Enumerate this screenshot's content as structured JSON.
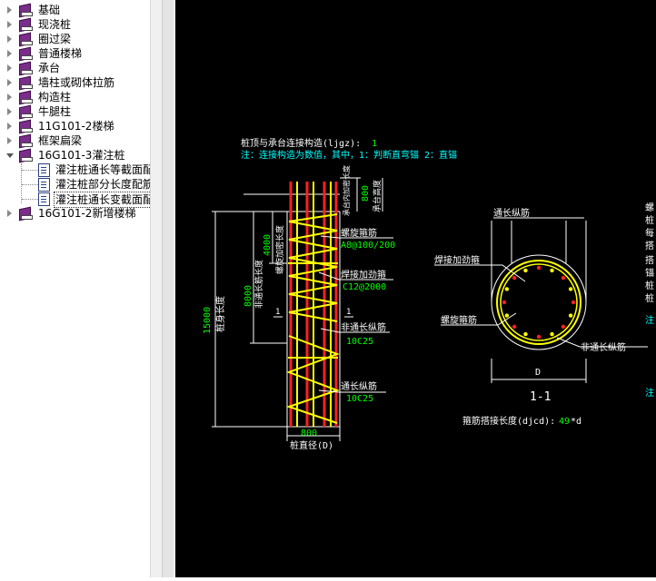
{
  "tree": {
    "items": [
      {
        "label": "基础",
        "type": "book"
      },
      {
        "label": "现浇桩",
        "type": "book"
      },
      {
        "label": "圈过梁",
        "type": "book"
      },
      {
        "label": "普通楼梯",
        "type": "book"
      },
      {
        "label": "承台",
        "type": "book"
      },
      {
        "label": "墙柱或砌体拉筋",
        "type": "book"
      },
      {
        "label": "构造柱",
        "type": "book"
      },
      {
        "label": "牛腿柱",
        "type": "book"
      },
      {
        "label": "11G101-2楼梯",
        "type": "book"
      },
      {
        "label": "框架扁梁",
        "type": "book"
      },
      {
        "label": "16G101-3灌注桩",
        "type": "open-book"
      },
      {
        "label": "灌注桩通长等截面配",
        "type": "doc"
      },
      {
        "label": "灌注桩部分长度配筋",
        "type": "doc"
      },
      {
        "label": "灌注桩通长变截面配",
        "type": "doc",
        "selected": true
      },
      {
        "label": "16G101-2新增楼梯",
        "type": "book"
      }
    ]
  },
  "drawing": {
    "line1": "桩顶与承台连接构造(ljgz):",
    "line1_value": "1",
    "line2": "注：连接构造为数值，其中，1：判断直弯锚      2：直锚",
    "dim_800_top": "800",
    "label_cap_anchor": "承台高度",
    "label_cap_extend": "承台内加密长度",
    "dim_4000": "4000",
    "label_dense_len": "螺旋加密长度",
    "dim_8000": "8000",
    "label_nonthrough_len": "非通长筋长度",
    "dim_15000": "15000",
    "label_pile_len": "桩身长度",
    "section_mark": "1",
    "spiral_label": "螺旋箍筋",
    "spiral_value": "A8@100/200",
    "weld_label": "焊接加劲箍",
    "weld_value": "C12@2000",
    "nonthrough_label": "非通长纵筋",
    "nonthrough_value": "10C25",
    "through_label": "通长纵筋",
    "through_value": "10C25",
    "dim_800_bottom": "800",
    "pile_diameter": "桩直径(D)",
    "sec_through": "通长纵筋",
    "sec_weld": "焊接加劲箍",
    "sec_spiral": "螺旋箍筋",
    "sec_nonthrough": "非通长纵筋",
    "sec_D": "D",
    "sec_title": "1-1",
    "lap_label": "箍筋搭接长度(djcd):",
    "lap_value": "49",
    "lap_suffix": "*d",
    "right_cut": [
      "螺",
      "桩",
      "每",
      "搭",
      "搭",
      "锚",
      "桩",
      "桩"
    ],
    "right_note1": "注",
    "right_note2": "注"
  },
  "colors": {
    "canvas_bg": "#000000",
    "white": "#ffffff",
    "cyan": "#00ffff",
    "green": "#00ff00",
    "yellow": "#ffff00",
    "red": "#ff2020"
  }
}
